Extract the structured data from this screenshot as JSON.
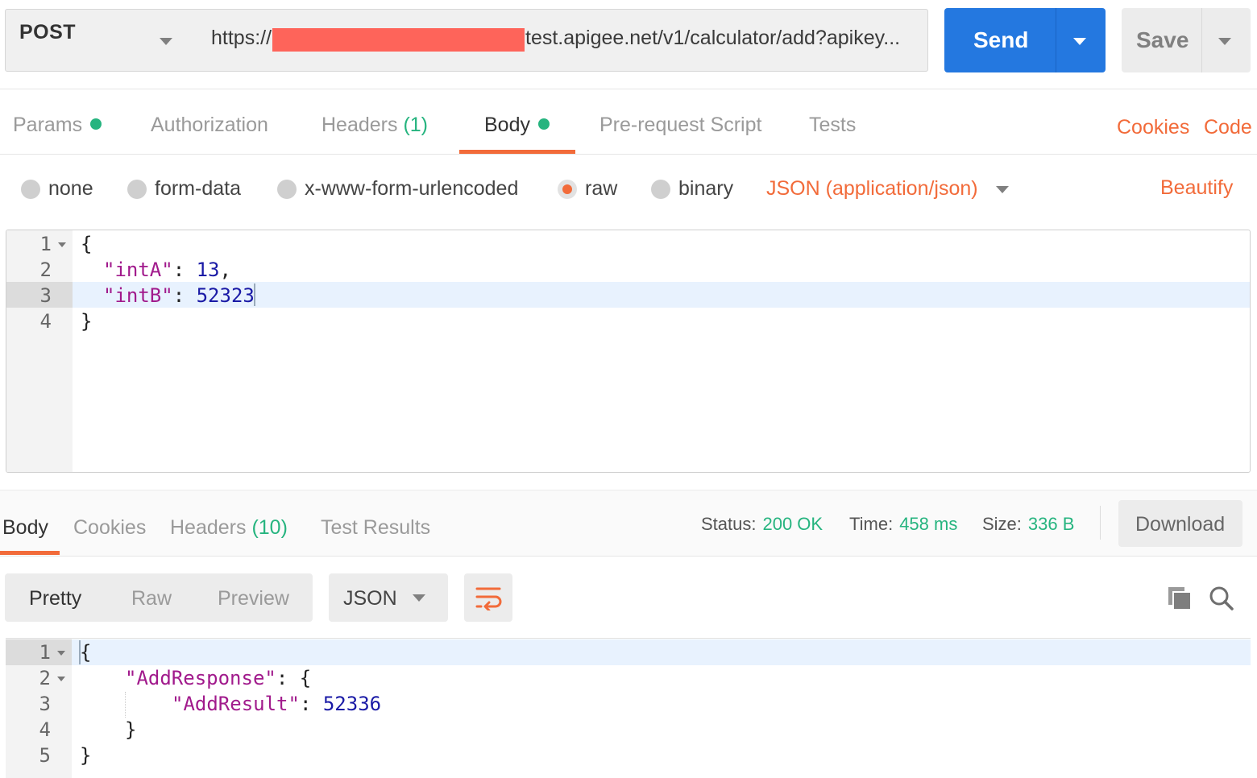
{
  "request": {
    "method": "POST",
    "url_prefix": "https://",
    "url_rest": "test.apigee.net/v1/calculator/add?apikey...",
    "send_label": "Send",
    "save_label": "Save"
  },
  "tabs": {
    "params": "Params",
    "authorization": "Authorization",
    "headers": "Headers",
    "headers_count": "(1)",
    "body": "Body",
    "prerequest": "Pre-request Script",
    "tests": "Tests",
    "cookies": "Cookies",
    "code": "Code"
  },
  "body_types": {
    "none": "none",
    "form_data": "form-data",
    "urlencoded": "x-www-form-urlencoded",
    "raw": "raw",
    "binary": "binary",
    "selected": "raw",
    "content_type": "JSON (application/json)",
    "beautify": "Beautify"
  },
  "request_body": {
    "line_numbers": [
      "1",
      "2",
      "3",
      "4"
    ],
    "open_brace": "{",
    "key_a": "\"intA\"",
    "val_a": "13",
    "key_b": "\"intB\"",
    "val_b": "52323",
    "close_brace": "}"
  },
  "response": {
    "tabs": {
      "body": "Body",
      "cookies": "Cookies",
      "headers": "Headers",
      "headers_count": "(10)",
      "test_results": "Test Results"
    },
    "status_label": "Status:",
    "status_value": "200 OK",
    "time_label": "Time:",
    "time_value": "458 ms",
    "size_label": "Size:",
    "size_value": "336 B",
    "download": "Download",
    "view_modes": [
      "Pretty",
      "Raw",
      "Preview"
    ],
    "active_view": "Pretty",
    "format": "JSON",
    "body": {
      "line_numbers": [
        "1",
        "2",
        "3",
        "4",
        "5"
      ],
      "open_brace": "{",
      "key_outer": "\"AddResponse\"",
      "key_inner": "\"AddResult\"",
      "val_inner": "52336",
      "close_inner": "}",
      "close_outer": "}"
    }
  },
  "colors": {
    "accent": "#f26b3a",
    "send": "#2478e0",
    "success": "#26b47f",
    "redaction": "#fe645a"
  },
  "icons": [
    "chevron-down-icon",
    "wrap-lines-icon",
    "copy-icon",
    "search-icon",
    "fold-arrow-icon"
  ]
}
